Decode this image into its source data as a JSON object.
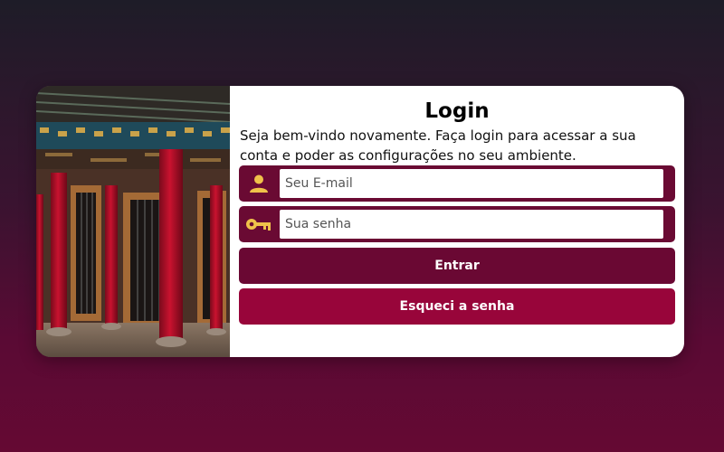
{
  "login": {
    "title": "Login",
    "welcome_text": "Seja bem-vindo novamente. Faça login para acessar a sua conta e poder as configurações no seu ambiente.",
    "email_placeholder": "Seu E-mail",
    "password_placeholder": "Sua senha",
    "enter_label": "Entrar",
    "forgot_label": "Esqueci a senha",
    "email_icon": "user-icon",
    "password_icon": "key-icon"
  },
  "colors": {
    "field_background": "#6a0a33",
    "enter_button": "#6a0833",
    "forgot_button": "#98053a",
    "icon": "#f0c24a"
  },
  "image": {
    "subject": "red pillars of traditional Chinese temple"
  }
}
